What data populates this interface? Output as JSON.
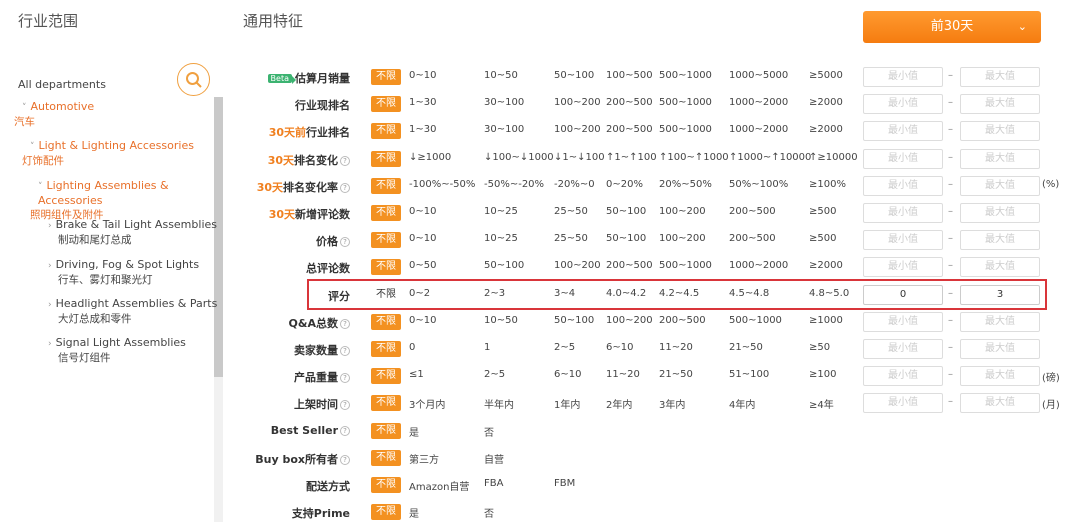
{
  "header": {
    "left_title": "行业范围",
    "right_title": "通用特征",
    "date_range": "前30天"
  },
  "tree": {
    "root": "All departments",
    "nodes": [
      {
        "en": "Automotive",
        "zh": "汽车",
        "level": 1
      },
      {
        "en": "Light & Lighting Accessories",
        "zh": "灯饰配件",
        "level": 2
      },
      {
        "en": "Lighting Assemblies & Accessories",
        "zh": "照明组件及附件",
        "level": 3
      },
      {
        "en": "Brake & Tail Light Assemblies",
        "zh": "制动和尾灯总成",
        "level": 4
      },
      {
        "en": "Driving, Fog & Spot Lights",
        "zh": "行车、雾灯和聚光灯",
        "level": 4
      },
      {
        "en": "Headlight Assemblies & Parts",
        "zh": "大灯总成和零件",
        "level": 4
      },
      {
        "en": "Signal Light Assemblies",
        "zh": "信号灯组件",
        "level": 4
      }
    ]
  },
  "filters": {
    "tag_label": "不限",
    "min_placeholder": "最小值",
    "max_placeholder": "最大值",
    "dash": "–",
    "rows": [
      {
        "pre": "",
        "label": "估算月销量",
        "beta": "Beta",
        "help": false,
        "options": [
          "0~10",
          "10~50",
          "50~100",
          "100~500",
          "500~1000",
          "1000~5000",
          "≥5000"
        ],
        "inputs": true,
        "unit": ""
      },
      {
        "pre": "",
        "label": "行业现排名",
        "help": false,
        "options": [
          "1~30",
          "30~100",
          "100~200",
          "200~500",
          "500~1000",
          "1000~2000",
          "≥2000"
        ],
        "inputs": true,
        "unit": ""
      },
      {
        "pre": "30天前",
        "label": "行业排名",
        "help": false,
        "options": [
          "1~30",
          "30~100",
          "100~200",
          "200~500",
          "500~1000",
          "1000~2000",
          "≥2000"
        ],
        "inputs": true,
        "unit": ""
      },
      {
        "pre": "30天",
        "label": "排名变化",
        "help": true,
        "options": [
          "↓≥1000",
          "↓100~↓1000",
          "↓1~↓100",
          "↑1~↑100",
          "↑100~↑1000",
          "↑1000~↑10000",
          "↑≥10000"
        ],
        "inputs": true,
        "unit": ""
      },
      {
        "pre": "30天",
        "label": "排名变化率",
        "help": true,
        "options": [
          "-100%~-50%",
          "-50%~-20%",
          "-20%~0",
          "0~20%",
          "20%~50%",
          "50%~100%",
          "≥100%"
        ],
        "inputs": true,
        "unit": "(%)"
      },
      {
        "pre": "30天",
        "label": "新增评论数",
        "help": false,
        "options": [
          "0~10",
          "10~25",
          "25~50",
          "50~100",
          "100~200",
          "200~500",
          "≥500"
        ],
        "inputs": true,
        "unit": ""
      },
      {
        "pre": "",
        "label": "价格",
        "help": true,
        "options": [
          "0~10",
          "10~25",
          "25~50",
          "50~100",
          "100~200",
          "200~500",
          "≥500"
        ],
        "inputs": true,
        "unit": ""
      },
      {
        "pre": "",
        "label": "总评论数",
        "help": false,
        "options": [
          "0~50",
          "50~100",
          "100~200",
          "200~500",
          "500~1000",
          "1000~2000",
          "≥2000"
        ],
        "inputs": true,
        "unit": ""
      },
      {
        "pre": "",
        "label": "评分",
        "help": false,
        "plain": true,
        "options": [
          "0~2",
          "2~3",
          "3~4",
          "4.0~4.2",
          "4.2~4.5",
          "4.5~4.8",
          "4.8~5.0"
        ],
        "inputs": true,
        "min_value": "0",
        "max_value": "3",
        "unit": ""
      },
      {
        "pre": "",
        "label": "Q&A总数",
        "help": true,
        "options": [
          "0~10",
          "10~50",
          "50~100",
          "100~200",
          "200~500",
          "500~1000",
          "≥1000"
        ],
        "inputs": true,
        "unit": ""
      },
      {
        "pre": "",
        "label": "卖家数量",
        "help": true,
        "options": [
          "0",
          "1",
          "2~5",
          "6~10",
          "11~20",
          "21~50",
          "≥50"
        ],
        "inputs": true,
        "unit": ""
      },
      {
        "pre": "",
        "label": "产品重量",
        "help": true,
        "options": [
          "≤1",
          "2~5",
          "6~10",
          "11~20",
          "21~50",
          "51~100",
          "≥100"
        ],
        "inputs": true,
        "unit": "(磅)"
      },
      {
        "pre": "",
        "label": "上架时间",
        "help": true,
        "options": [
          "3个月内",
          "半年内",
          "1年内",
          "2年内",
          "3年内",
          "4年内",
          "≥4年"
        ],
        "inputs": true,
        "unit": "(月)"
      },
      {
        "pre": "",
        "label": "Best Seller",
        "help": true,
        "options": [
          "是",
          "否"
        ],
        "inputs": false,
        "unit": ""
      },
      {
        "pre": "",
        "label": "Buy box所有者",
        "help": true,
        "options": [
          "第三方",
          "自营"
        ],
        "inputs": false,
        "unit": ""
      },
      {
        "pre": "",
        "label": "配送方式",
        "help": false,
        "options": [
          "Amazon自营",
          "FBA",
          "FBM"
        ],
        "inputs": false,
        "unit": ""
      },
      {
        "pre": "",
        "label": "支持Prime",
        "help": false,
        "options": [
          "是",
          "否"
        ],
        "inputs": false,
        "unit": ""
      }
    ]
  }
}
